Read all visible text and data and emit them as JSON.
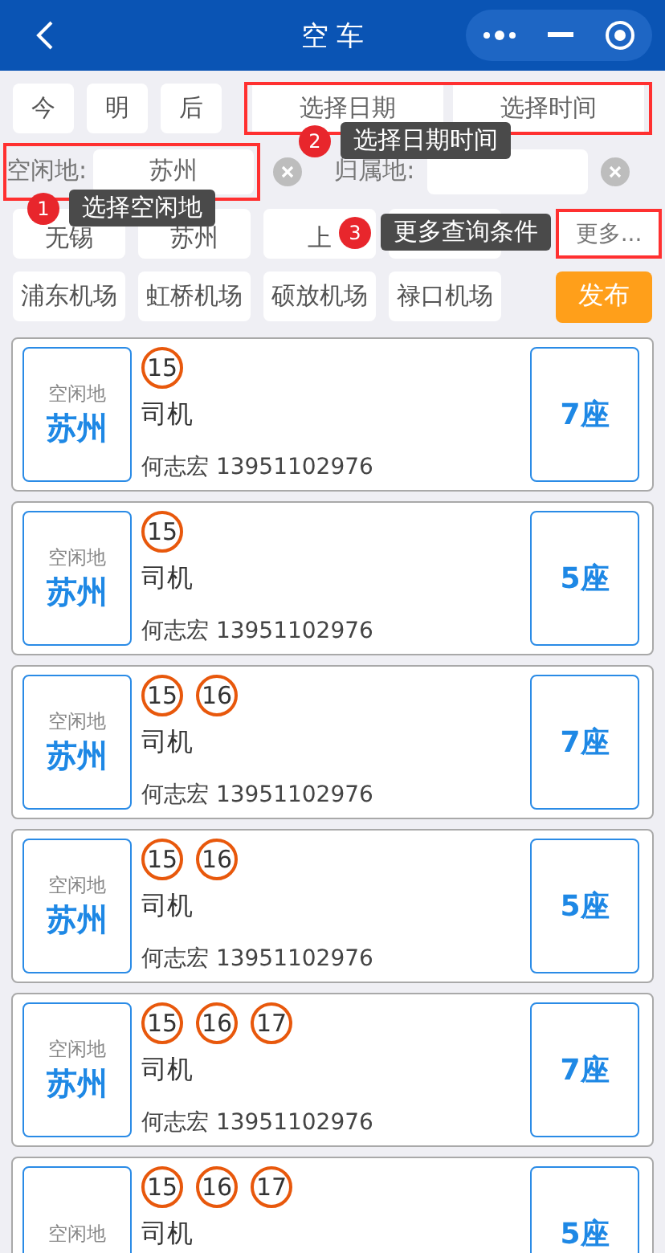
{
  "header": {
    "title": "空 车"
  },
  "days": [
    "今",
    "明",
    "后"
  ],
  "date_field": {
    "placeholder": "选择日期"
  },
  "time_field": {
    "placeholder": "选择时间"
  },
  "idle_place": {
    "label": "空闲地:",
    "value": "苏州"
  },
  "home_place": {
    "label": "归属地:"
  },
  "quick_cities": [
    "无锡",
    "苏州",
    "上"
  ],
  "more": "更多...",
  "airports": [
    "浦东机场",
    "虹桥机场",
    "硕放机场",
    "禄口机场"
  ],
  "publish": "发布",
  "annotations": [
    {
      "number": "1",
      "text": "选择空闲地"
    },
    {
      "number": "2",
      "text": "选择日期时间"
    },
    {
      "number": "3",
      "text": "更多查询条件"
    }
  ],
  "cards": [
    {
      "label": "空闲地",
      "place": "苏州",
      "days": [
        "15"
      ],
      "role": "司机",
      "contact": "何志宏 13951102976",
      "seats": "7座"
    },
    {
      "label": "空闲地",
      "place": "苏州",
      "days": [
        "15"
      ],
      "role": "司机",
      "contact": "何志宏 13951102976",
      "seats": "5座"
    },
    {
      "label": "空闲地",
      "place": "苏州",
      "days": [
        "15",
        "16"
      ],
      "role": "司机",
      "contact": "何志宏 13951102976",
      "seats": "7座"
    },
    {
      "label": "空闲地",
      "place": "苏州",
      "days": [
        "15",
        "16"
      ],
      "role": "司机",
      "contact": "何志宏 13951102976",
      "seats": "5座"
    },
    {
      "label": "空闲地",
      "place": "苏州",
      "days": [
        "15",
        "16",
        "17"
      ],
      "role": "司机",
      "contact": "何志宏 13951102976",
      "seats": "7座"
    },
    {
      "label": "空闲地",
      "days": [
        "15",
        "16",
        "17"
      ],
      "role": "司机",
      "seats": "5座"
    }
  ]
}
